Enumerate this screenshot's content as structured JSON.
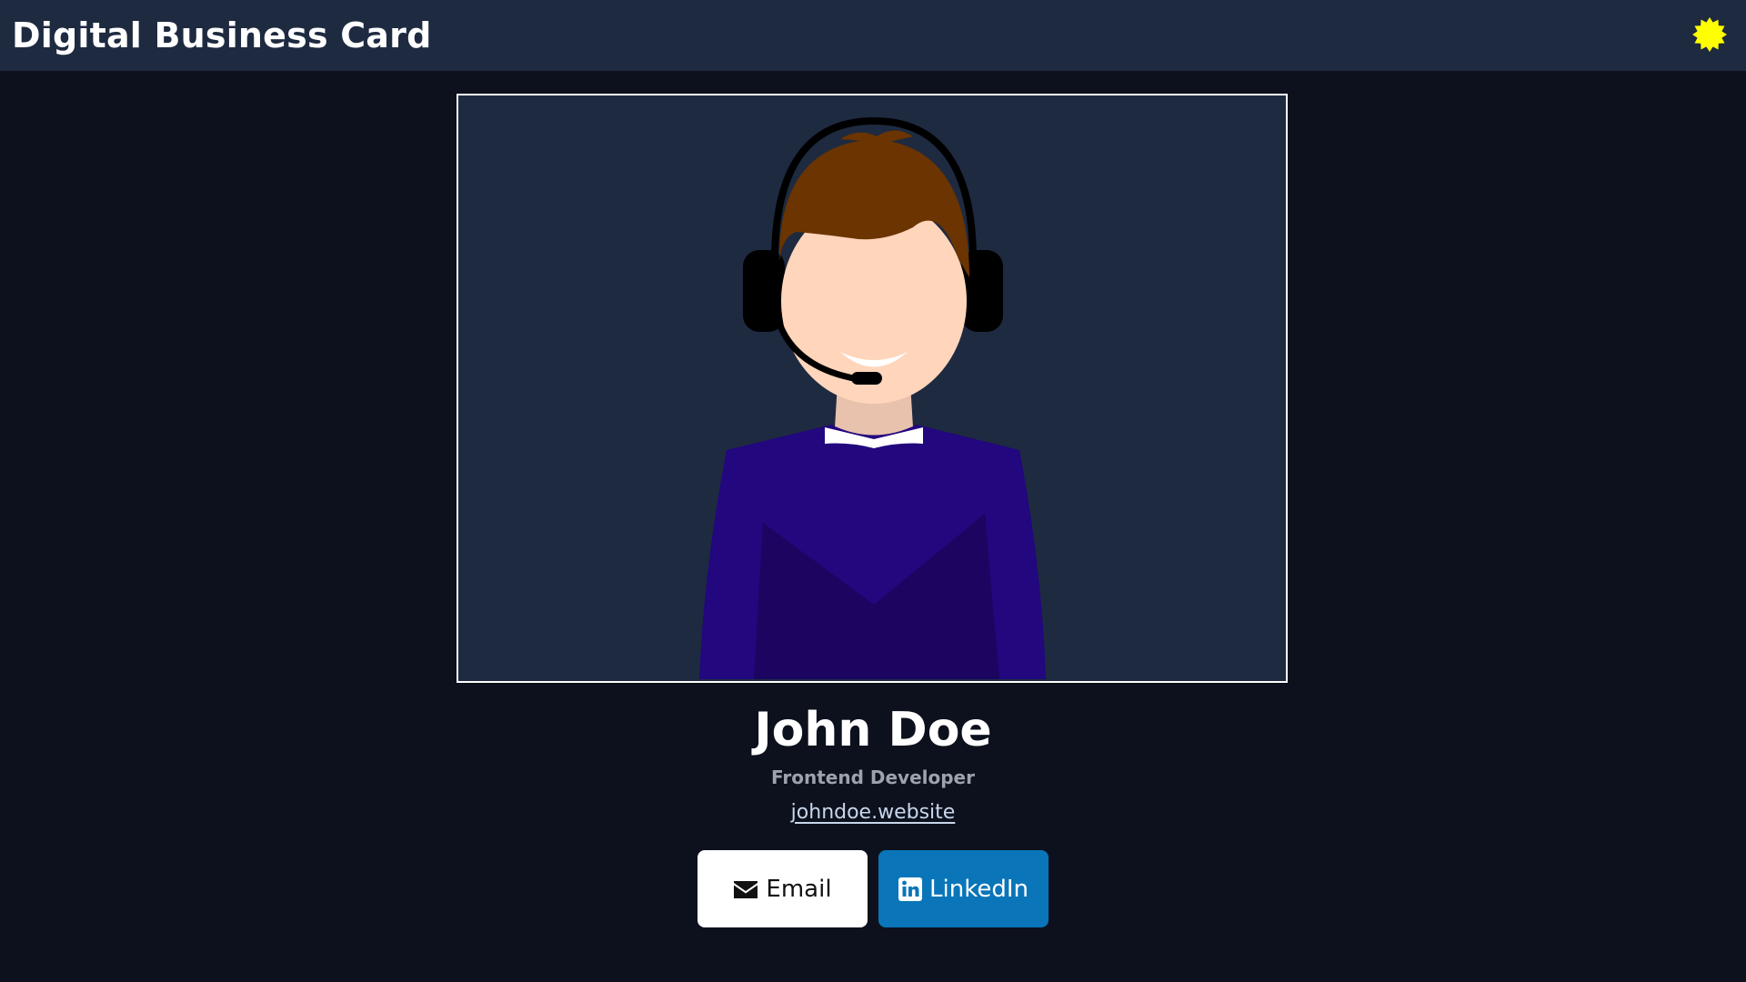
{
  "header": {
    "title": "Digital Business Card",
    "theme_icon": "sun-icon",
    "theme_icon_color": "#ffff00"
  },
  "profile": {
    "photo_icon": "person-with-headset-illustration",
    "name": "John Doe",
    "role": "Frontend Developer",
    "website": "johndoe.website"
  },
  "buttons": {
    "email_label": "Email",
    "email_icon": "envelope-icon",
    "linkedin_label": "LinkedIn",
    "linkedin_icon": "linkedin-icon"
  },
  "colors": {
    "page_background": "#0c111d",
    "header_background": "#1e2a40",
    "photo_background": "#1e2a40",
    "email_button": "#ffffff",
    "linkedin_button": "#0a75b9",
    "role_text": "#9ca3af"
  }
}
